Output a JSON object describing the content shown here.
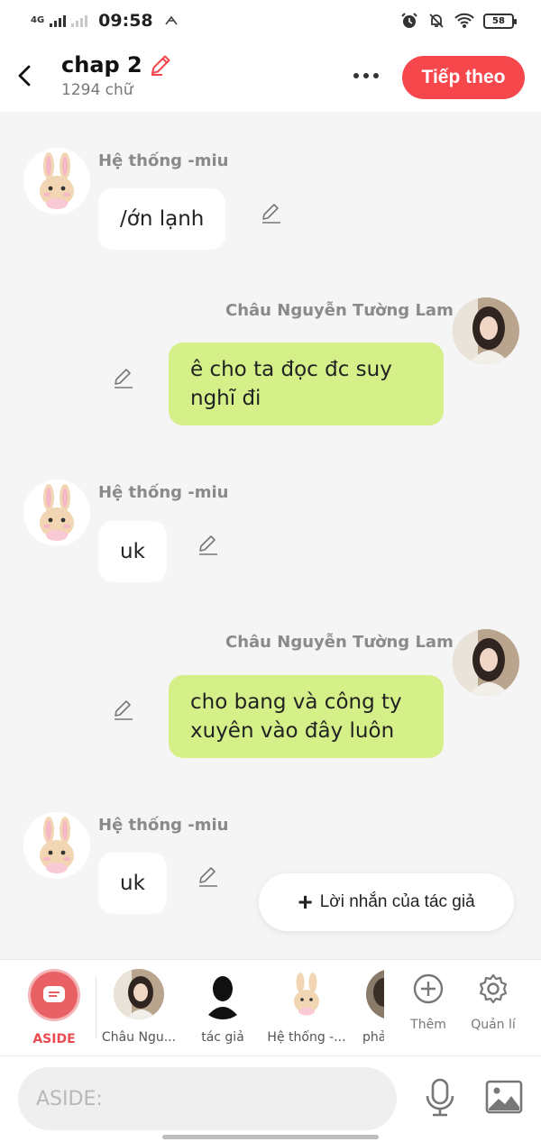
{
  "status_bar": {
    "network": "4G",
    "time": "09:58",
    "battery": "58"
  },
  "header": {
    "title": "chap 2",
    "word_count": "1294 chữ",
    "next_label": "Tiếp theo"
  },
  "messages": [
    {
      "sender": "Hệ thống -miu",
      "text": "/ớn lạnh",
      "side": "left"
    },
    {
      "sender": "Châu Nguyễn Tường Lam",
      "text": "ê cho ta đọc đc suy nghĩ đi",
      "side": "right"
    },
    {
      "sender": "Hệ thống -miu",
      "text": "uk",
      "side": "left"
    },
    {
      "sender": "Châu Nguyễn Tường Lam",
      "text": "cho bang và công ty xuyên vào đây luôn",
      "side": "right"
    },
    {
      "sender": "Hệ thống -miu",
      "text": "uk",
      "side": "left"
    }
  ],
  "author_note_label": "Lời nhắn của tác giả",
  "characters": [
    {
      "label": "ASIDE"
    },
    {
      "label": "Châu Ngu..."
    },
    {
      "label": "tác giả"
    },
    {
      "label": "Hệ thống -..."
    },
    {
      "label": "phả"
    }
  ],
  "tools": {
    "add_label": "Thêm",
    "manage_label": "Quản lí"
  },
  "input": {
    "placeholder": "ASIDE:"
  },
  "colors": {
    "accent": "#f6474d",
    "bubble_right": "#d6f089",
    "background": "#f5f5f5"
  }
}
